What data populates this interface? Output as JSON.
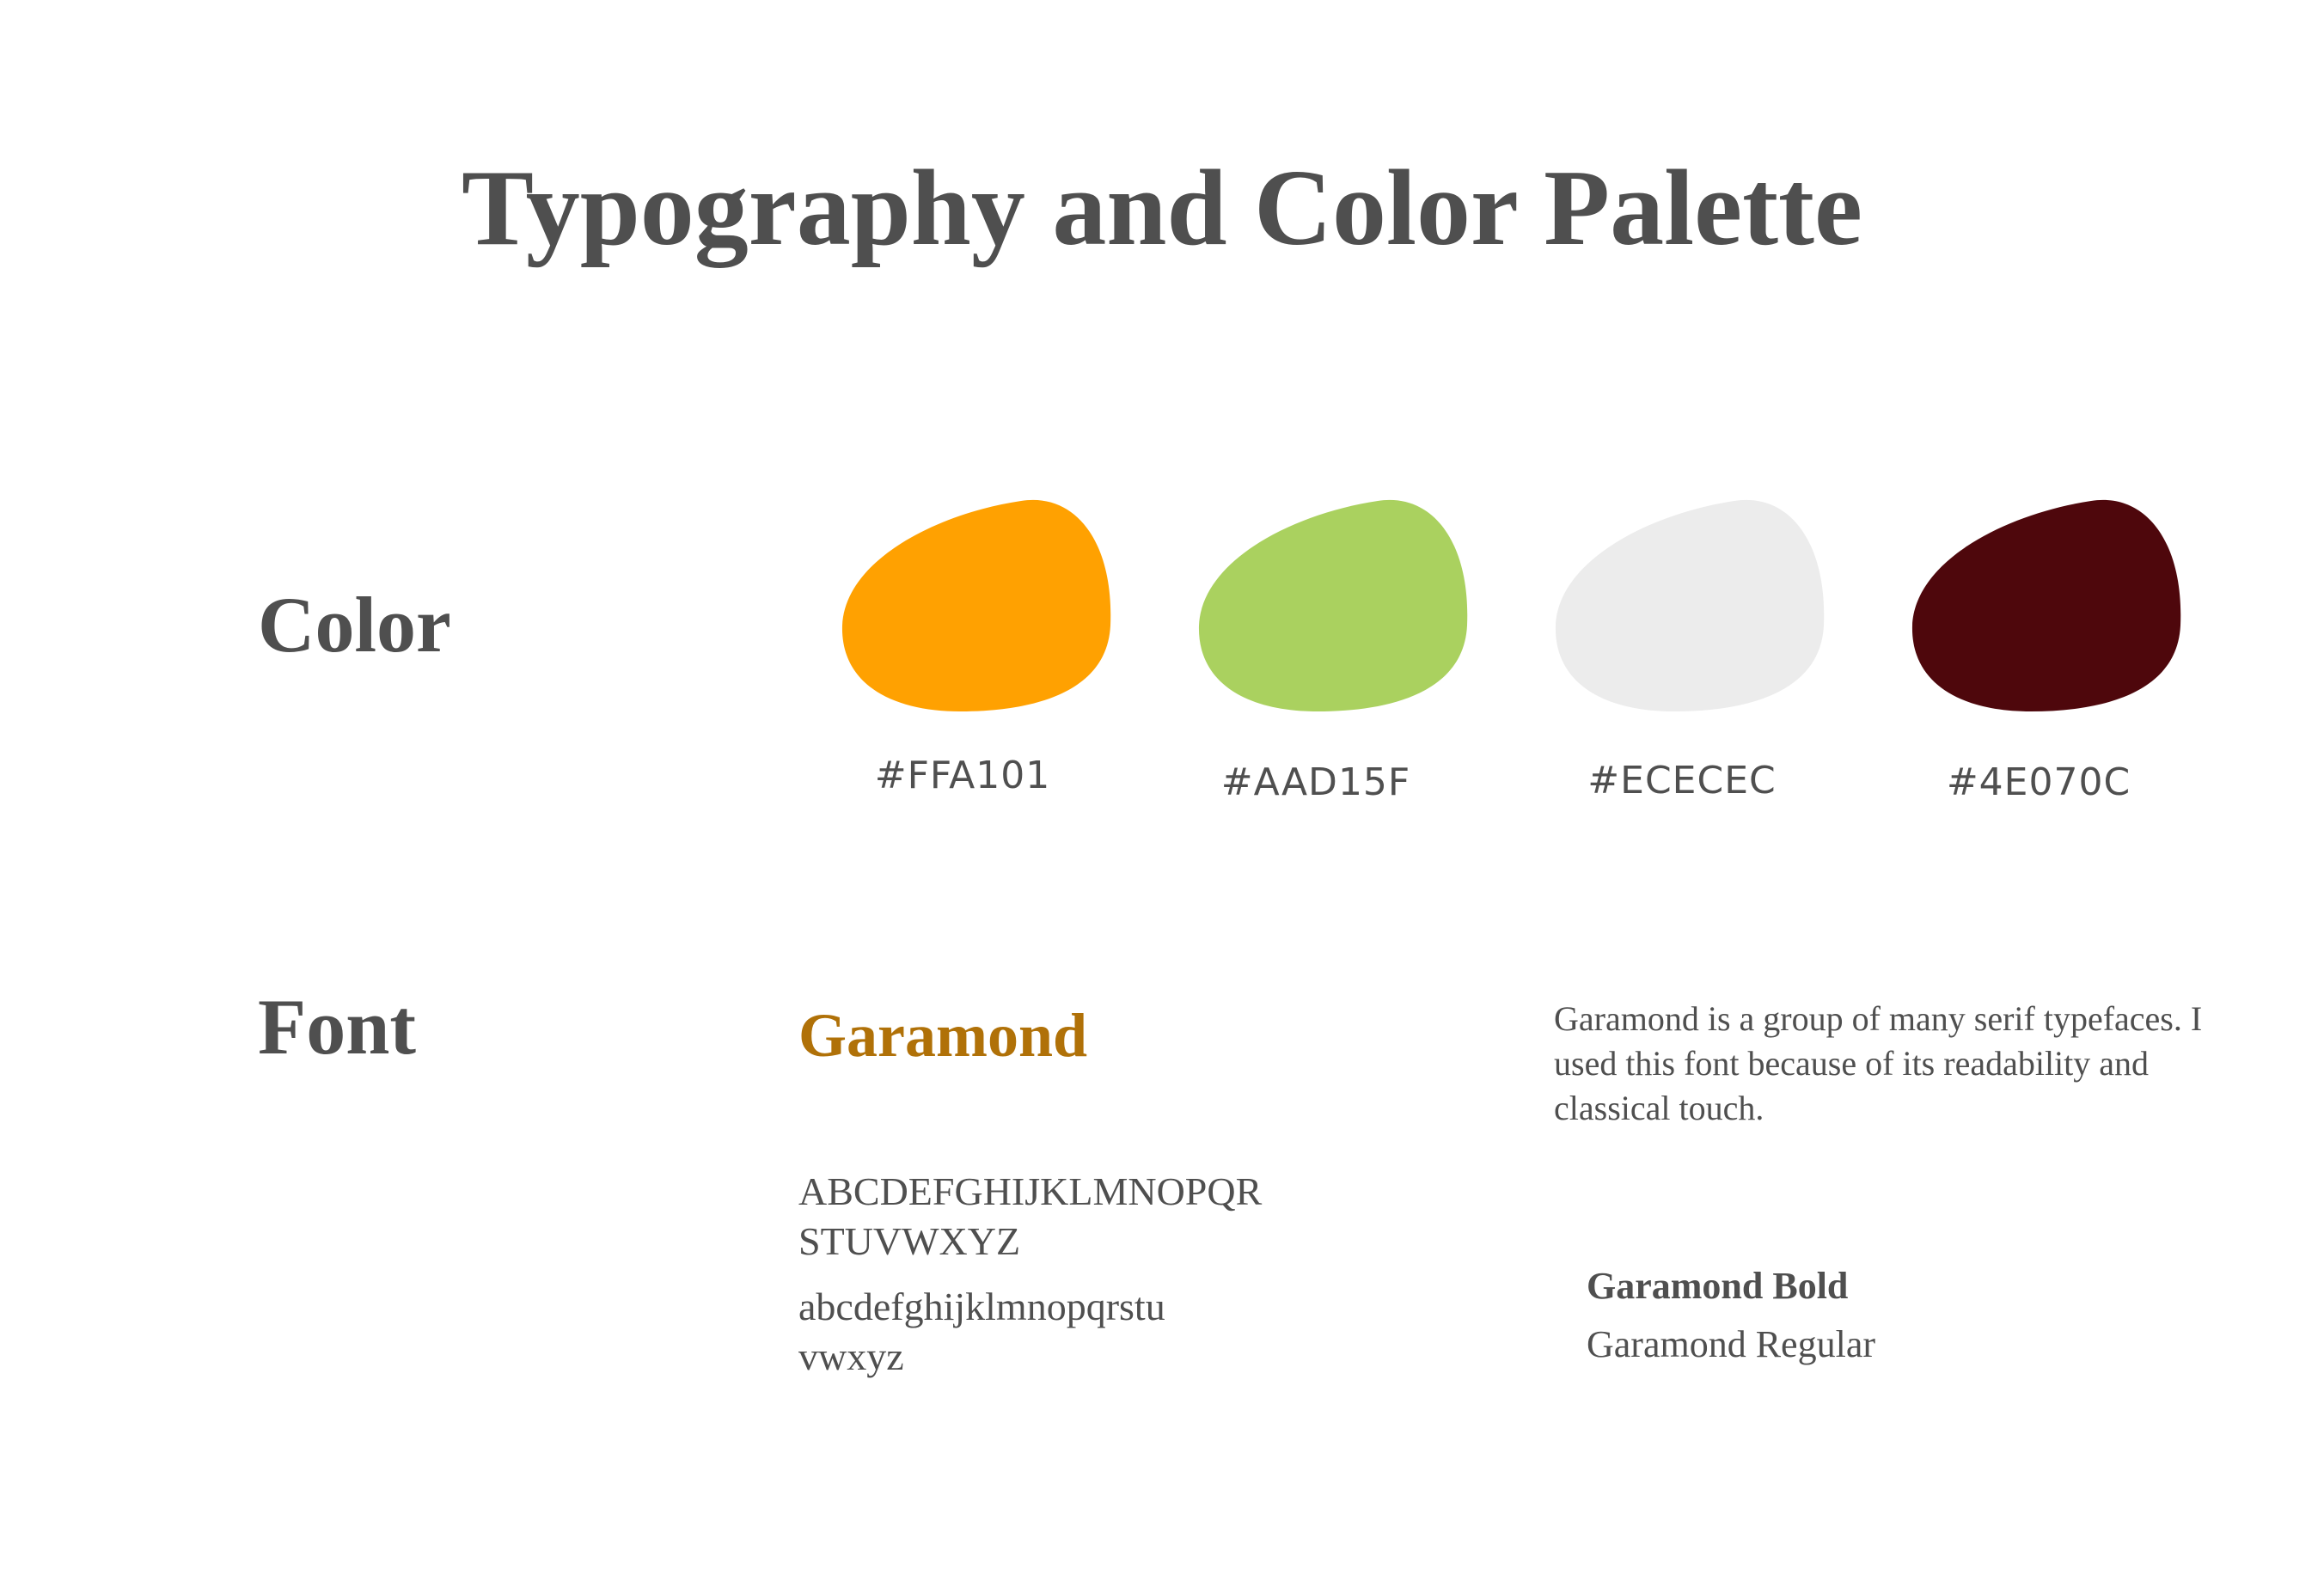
{
  "page": {
    "title": "Typography and Color Palette"
  },
  "color_section": {
    "label": "Color",
    "swatches": [
      {
        "code": "#FFA101",
        "color": "#FFA101"
      },
      {
        "code": "#AAD15F",
        "color": "#AAD15F"
      },
      {
        "code": "#ECECEC",
        "color": "#ECECEC"
      },
      {
        "code": "#4E070C",
        "color": "#4E070C"
      }
    ]
  },
  "font_section": {
    "label": "Font",
    "font_name": "Garamond",
    "font_name_color": "#B07108",
    "uppercase_line1": "ABCDEFGHIJKLMNOPQR",
    "uppercase_line2": "STUVWXYZ",
    "lowercase_line1": "abcdefghijklmnopqrstu",
    "lowercase_line2": "vwxyz",
    "description": "Garamond is a group of many serif typefaces. I used this font because of its readability and classical touch.",
    "weight_bold": "Garamond Bold",
    "weight_regular": "Garamond Regular"
  }
}
